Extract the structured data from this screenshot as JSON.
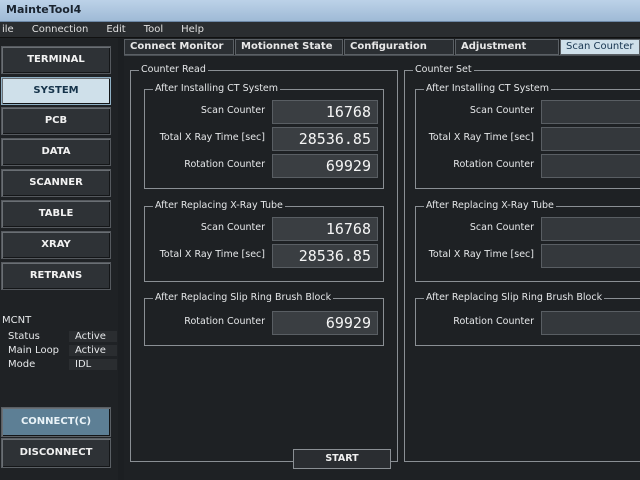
{
  "window": {
    "title": "MainteTool4"
  },
  "menu": [
    "ile",
    "Connection",
    "Edit",
    "Tool",
    "Help"
  ],
  "sidebar": {
    "items": [
      "TERMINAL",
      "SYSTEM",
      "PCB",
      "DATA",
      "SCANNER",
      "TABLE",
      "XRAY",
      "RETRANS"
    ],
    "active": "SYSTEM"
  },
  "status": {
    "header": "MCNT",
    "rows": [
      {
        "key": "Status",
        "value": "Active"
      },
      {
        "key": "Main Loop",
        "value": "Active"
      },
      {
        "key": "Mode",
        "value": "IDL"
      }
    ]
  },
  "buttons": {
    "connect": "CONNECT(C)",
    "disconnect": "DISCONNECT",
    "start": "START"
  },
  "tabs": [
    "Connect Monitor",
    "Motionnet State",
    "Configuration",
    "Adjustment",
    "Scan Counter"
  ],
  "active_tab": "Scan Counter",
  "counter_read": {
    "title": "Counter Read",
    "ct_system": {
      "title": "After Installing CT System",
      "scan_counter_label": "Scan Counter",
      "scan_counter": "16768",
      "xray_time_label": "Total X Ray Time [sec]",
      "xray_time": "28536.85",
      "rotation_label": "Rotation Counter",
      "rotation": "69929"
    },
    "xray_tube": {
      "title": "After Replacing X-Ray Tube",
      "scan_counter_label": "Scan Counter",
      "scan_counter": "16768",
      "xray_time_label": "Total X Ray Time [sec]",
      "xray_time": "28536.85"
    },
    "slip_ring": {
      "title": "After Replacing Slip Ring Brush Block",
      "rotation_label": "Rotation Counter",
      "rotation": "69929"
    }
  },
  "counter_set": {
    "title": "Counter Set",
    "ct_system": {
      "title": "After Installing CT System",
      "scan_counter_label": "Scan Counter",
      "xray_time_label": "Total X Ray Time [sec]",
      "rotation_label": "Rotation Counter"
    },
    "xray_tube": {
      "title": "After Replacing X-Ray Tube",
      "scan_counter_label": "Scan Counter",
      "xray_time_label": "Total X Ray Time [sec]"
    },
    "slip_ring": {
      "title": "After Replacing Slip Ring Brush Block",
      "rotation_label": "Rotation Counter"
    }
  }
}
